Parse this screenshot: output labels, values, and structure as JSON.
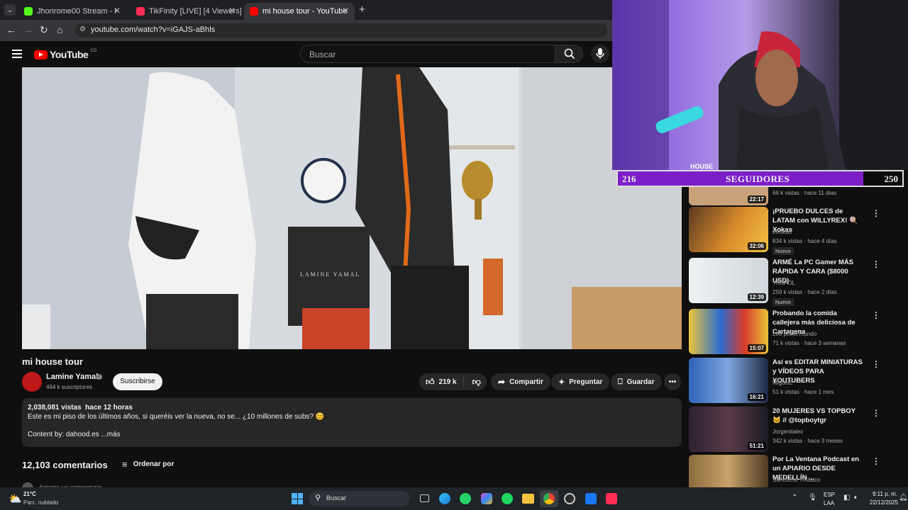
{
  "browser": {
    "tabs": [
      {
        "label": "Jhonrome00 Stream - Kick Da",
        "color": "#53fc18"
      },
      {
        "label": "TikFinity [LIVE] [4 Viewers]",
        "color": "#ff2d55"
      },
      {
        "label": "mi house tour - YouTube",
        "color": "#ff0000"
      }
    ],
    "url": "youtube.com/watch?v=iGAJS-aBhls"
  },
  "youtube": {
    "logo": "YouTube",
    "country": "CO",
    "search_placeholder": "Buscar"
  },
  "video": {
    "title": "mi house tour",
    "channel": "Lamine Yamal",
    "subscribers": "464 k suscriptores",
    "subscribe_label": "Suscribirse",
    "likes": "219 k",
    "share_label": "Compartir",
    "ask_label": "Preguntar",
    "save_label": "Guardar",
    "box_text": "LAMINE YAMAL",
    "stats": "2,038,081 vistas  hace 12 horas",
    "description": "Este es mi piso de los últimos años, si queréis ver la nueva, no se... ¿10 millones de subs? 😊",
    "content_by": "Content by: dahood.es ...más",
    "comments_count": "12,103 comentarios",
    "sort_label": "Ordenar por",
    "add_comment": "Agrega un comentario..."
  },
  "overlay": {
    "left_num": "216",
    "label": "SEGUIDORES",
    "right_num": "250",
    "progress": 0.864,
    "webcam_text": "HOUSE"
  },
  "recommendations": [
    {
      "title": "",
      "channel": "",
      "meta": "66 k vistas · hace 11 días",
      "duration": "22:17",
      "new": "",
      "color": "#c9a27a"
    },
    {
      "title": "¡PRUEBO DULCES de LATAM con WILLYREX! 🍭 Xokas",
      "channel": "elxokas",
      "meta": "834 k vistas · hace 4 días",
      "duration": "32:06",
      "new": "Nuevo",
      "color": "#d98b2b"
    },
    {
      "title": "ARMÉ La PC Gamer MÁS RÁPIDA Y CARA ($8000 USD)",
      "channel": "YANPOL",
      "meta": "259 k vistas · hace 2 días",
      "duration": "12:39",
      "new": "Nuevo",
      "color": "#dfe7ea"
    },
    {
      "title": "Probando la comida callejera más deliciosa de Cartagena",
      "channel": "Leo por el mundo",
      "meta": "71 k vistas · hace 3 semanas",
      "duration": "15:07",
      "new": "",
      "color": "#e9c53a"
    },
    {
      "title": "Así es EDITAR MINIATURAS y VÍDEOS PARA YOUTUBERS",
      "channel": "MiguelZ",
      "meta": "51 k vistas · hace 1 mes",
      "duration": "16:21",
      "new": "",
      "color": "#3a6fb3"
    },
    {
      "title": "20 MUJERES VS TOPBOY 🐱 // @topboytgr",
      "channel": "Jorgenitalex",
      "meta": "342 k vistas · hace 3 meses",
      "duration": "51:21",
      "new": "",
      "color": "#3b2f3d"
    },
    {
      "title": "Por La Ventana Podcast en un APIARIO DESDE MEDELLÍN ...",
      "channel": "Sancocho Trifásico",
      "meta": "",
      "duration": "",
      "new": "",
      "color": "#8b6a3c"
    }
  ],
  "taskbar": {
    "temp": "21°C",
    "weather": "Parc. nublado",
    "search": "Buscar",
    "lang1": "ESP",
    "lang2": "LAA",
    "time": "9:11 p. m.",
    "date": "22/12/2025"
  }
}
